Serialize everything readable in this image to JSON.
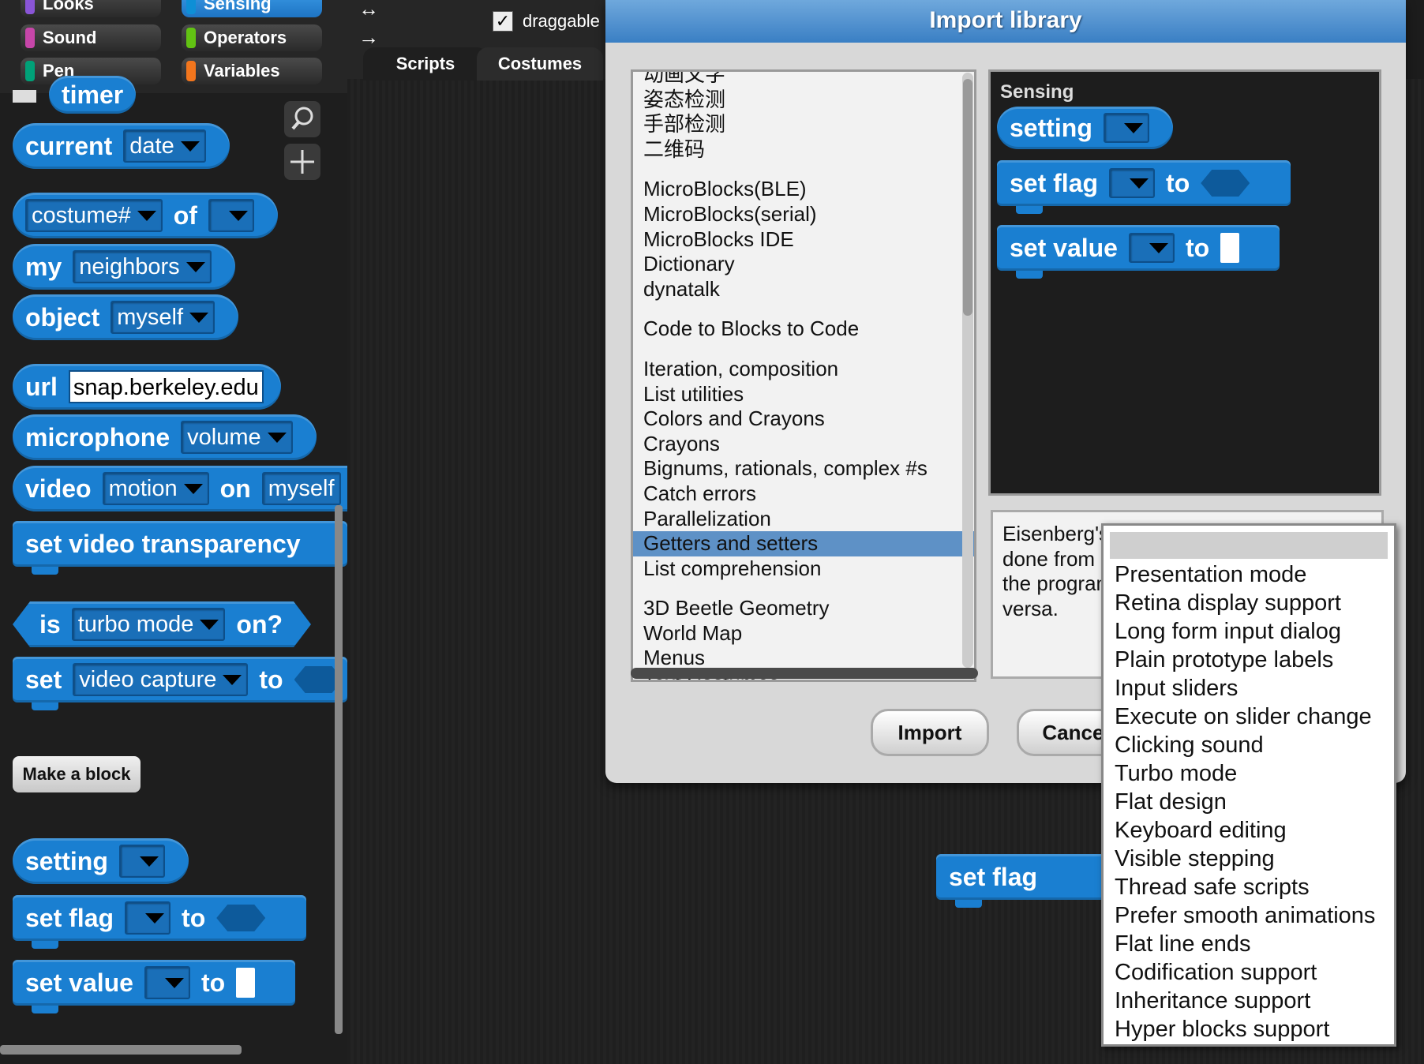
{
  "categories": [
    {
      "label": "Looks",
      "color": "#8a55d7",
      "selected": false
    },
    {
      "label": "Sensing",
      "color": "#0e8fd6",
      "selected": true
    },
    {
      "label": "Sound",
      "color": "#c746a9",
      "selected": false
    },
    {
      "label": "Operators",
      "color": "#62c213",
      "selected": false
    },
    {
      "label": "Pen",
      "color": "#00a178",
      "selected": false
    },
    {
      "label": "Variables",
      "color": "#f3761d",
      "selected": false
    }
  ],
  "palette": {
    "timer": "timer",
    "current": {
      "word": "current",
      "dropdown": "date"
    },
    "costume_of": {
      "dropdown": "costume#",
      "word": "of"
    },
    "my": {
      "word": "my",
      "dropdown": "neighbors"
    },
    "object": {
      "word": "object",
      "dropdown": "myself"
    },
    "url": {
      "word": "url",
      "value": "snap.berkeley.edu"
    },
    "microphone": {
      "word": "microphone",
      "dropdown": "volume"
    },
    "video": {
      "word": "video",
      "dropdown": "motion",
      "on": "on",
      "target": "myself"
    },
    "set_video_transparency": "set video transparency",
    "is_turbo": {
      "word": "is",
      "dropdown": "turbo mode",
      "tail": "on?"
    },
    "set_video_capture": {
      "word": "set",
      "dropdown": "video capture",
      "to": "to"
    },
    "make_block": "Make a block",
    "setting": {
      "word": "setting"
    },
    "set_flag": {
      "word": "set flag",
      "to": "to"
    },
    "set_value": {
      "word": "set value",
      "to": "to"
    }
  },
  "editor": {
    "draggable_checked": "✓",
    "draggable_label": "draggable",
    "tabs": [
      "Scripts",
      "Costumes"
    ],
    "script_block": "set flag"
  },
  "dialog": {
    "title": "Import library",
    "libraries": [
      "动画文字",
      "姿态检测",
      "手部检测",
      "二维码",
      "",
      "MicroBlocks(BLE)",
      "MicroBlocks(serial)",
      "MicroBlocks IDE",
      "Dictionary",
      "dynatalk",
      "",
      "Code to Blocks to Code",
      "",
      "Iteration, composition",
      "List utilities",
      "Colors and Crayons",
      "Crayons",
      "Bignums, rationals, complex #s",
      "Catch errors",
      "Parallelization",
      "Getters and setters",
      "List comprehension",
      "",
      "3D Beetle Geometry",
      "World Map",
      "Menus",
      "Text Costumes"
    ],
    "selected_library": "Getters and setters",
    "preview": {
      "category": "Sensing",
      "setting": "setting",
      "set_flag": "set flag",
      "set_value": "set value",
      "to": "to"
    },
    "description": [
      "Eisenberg's",
      "done from",
      "the program",
      "versa."
    ],
    "import_button": "Import",
    "cancel_button": "Cancel"
  },
  "menu": {
    "items": [
      "Presentation mode",
      "Retina display support",
      "Long form input dialog",
      "Plain prototype labels",
      "Input sliders",
      "Execute on slider change",
      "Clicking sound",
      "Turbo mode",
      "Flat design",
      "Keyboard editing",
      "Visible stepping",
      "Thread safe scripts",
      "Prefer smooth animations",
      "Flat line ends",
      "Codification support",
      "Inheritance support",
      "Hyper blocks support"
    ]
  }
}
